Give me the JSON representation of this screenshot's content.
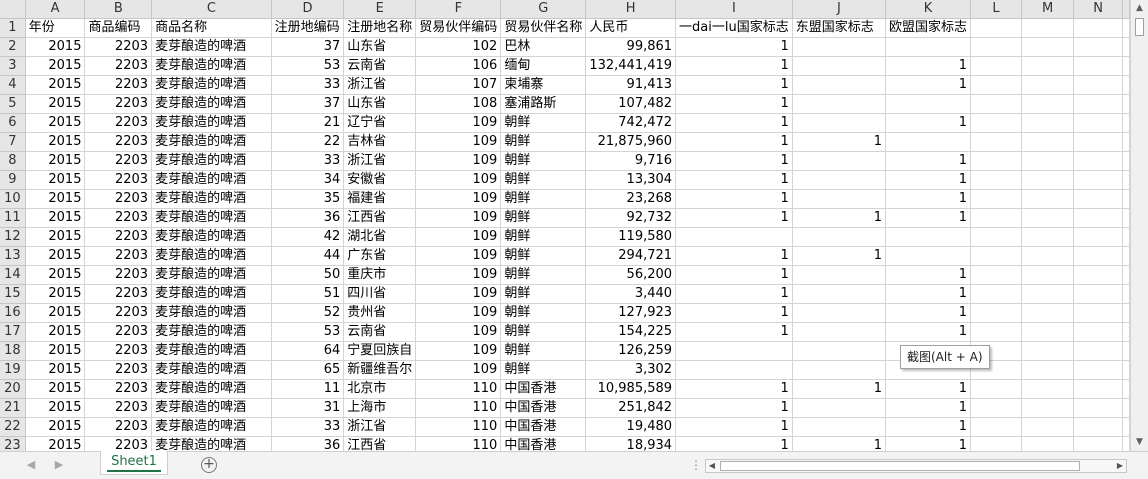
{
  "sheet": {
    "column_letters": [
      "A",
      "B",
      "C",
      "D",
      "E",
      "F",
      "G",
      "H",
      "I",
      "J",
      "K",
      "L",
      "M",
      "N"
    ],
    "header_row": {
      "row_number": "1",
      "cells": [
        "年份",
        "商品编码",
        "商品名称",
        "注册地编码",
        "注册地名称",
        "贸易伙伴编码",
        "贸易伙伴名称",
        "人民币",
        "一dai一lu国家标志",
        "东盟国家标志",
        "欧盟国家标志",
        "",
        "",
        ""
      ]
    },
    "rows": [
      {
        "n": "2",
        "year": "2015",
        "code": "2203",
        "name": "麦芽酿造的啤酒",
        "reg_code": "37",
        "reg_name": "山东省",
        "partner_code": "102",
        "partner_name": "巴林",
        "rmb": "99,861",
        "bri": "1",
        "asean": "",
        "eu": ""
      },
      {
        "n": "3",
        "year": "2015",
        "code": "2203",
        "name": "麦芽酿造的啤酒",
        "reg_code": "53",
        "reg_name": "云南省",
        "partner_code": "106",
        "partner_name": "缅甸",
        "rmb": "132,441,419",
        "bri": "1",
        "asean": "",
        "eu": "1"
      },
      {
        "n": "4",
        "year": "2015",
        "code": "2203",
        "name": "麦芽酿造的啤酒",
        "reg_code": "33",
        "reg_name": "浙江省",
        "partner_code": "107",
        "partner_name": "柬埔寨",
        "rmb": "91,413",
        "bri": "1",
        "asean": "",
        "eu": "1"
      },
      {
        "n": "5",
        "year": "2015",
        "code": "2203",
        "name": "麦芽酿造的啤酒",
        "reg_code": "37",
        "reg_name": "山东省",
        "partner_code": "108",
        "partner_name": "塞浦路斯",
        "rmb": "107,482",
        "bri": "1",
        "asean": "",
        "eu": ""
      },
      {
        "n": "6",
        "year": "2015",
        "code": "2203",
        "name": "麦芽酿造的啤酒",
        "reg_code": "21",
        "reg_name": "辽宁省",
        "partner_code": "109",
        "partner_name": "朝鲜",
        "rmb": "742,472",
        "bri": "1",
        "asean": "",
        "eu": "1"
      },
      {
        "n": "7",
        "year": "2015",
        "code": "2203",
        "name": "麦芽酿造的啤酒",
        "reg_code": "22",
        "reg_name": "吉林省",
        "partner_code": "109",
        "partner_name": "朝鲜",
        "rmb": "21,875,960",
        "bri": "1",
        "asean": "1",
        "eu": ""
      },
      {
        "n": "8",
        "year": "2015",
        "code": "2203",
        "name": "麦芽酿造的啤酒",
        "reg_code": "33",
        "reg_name": "浙江省",
        "partner_code": "109",
        "partner_name": "朝鲜",
        "rmb": "9,716",
        "bri": "1",
        "asean": "",
        "eu": "1"
      },
      {
        "n": "9",
        "year": "2015",
        "code": "2203",
        "name": "麦芽酿造的啤酒",
        "reg_code": "34",
        "reg_name": "安徽省",
        "partner_code": "109",
        "partner_name": "朝鲜",
        "rmb": "13,304",
        "bri": "1",
        "asean": "",
        "eu": "1"
      },
      {
        "n": "10",
        "year": "2015",
        "code": "2203",
        "name": "麦芽酿造的啤酒",
        "reg_code": "35",
        "reg_name": "福建省",
        "partner_code": "109",
        "partner_name": "朝鲜",
        "rmb": "23,268",
        "bri": "1",
        "asean": "",
        "eu": "1"
      },
      {
        "n": "11",
        "year": "2015",
        "code": "2203",
        "name": "麦芽酿造的啤酒",
        "reg_code": "36",
        "reg_name": "江西省",
        "partner_code": "109",
        "partner_name": "朝鲜",
        "rmb": "92,732",
        "bri": "1",
        "asean": "1",
        "eu": "1"
      },
      {
        "n": "12",
        "year": "2015",
        "code": "2203",
        "name": "麦芽酿造的啤酒",
        "reg_code": "42",
        "reg_name": "湖北省",
        "partner_code": "109",
        "partner_name": "朝鲜",
        "rmb": "119,580",
        "bri": "",
        "asean": "",
        "eu": ""
      },
      {
        "n": "13",
        "year": "2015",
        "code": "2203",
        "name": "麦芽酿造的啤酒",
        "reg_code": "44",
        "reg_name": "广东省",
        "partner_code": "109",
        "partner_name": "朝鲜",
        "rmb": "294,721",
        "bri": "1",
        "asean": "1",
        "eu": ""
      },
      {
        "n": "14",
        "year": "2015",
        "code": "2203",
        "name": "麦芽酿造的啤酒",
        "reg_code": "50",
        "reg_name": "重庆市",
        "partner_code": "109",
        "partner_name": "朝鲜",
        "rmb": "56,200",
        "bri": "1",
        "asean": "",
        "eu": "1"
      },
      {
        "n": "15",
        "year": "2015",
        "code": "2203",
        "name": "麦芽酿造的啤酒",
        "reg_code": "51",
        "reg_name": "四川省",
        "partner_code": "109",
        "partner_name": "朝鲜",
        "rmb": "3,440",
        "bri": "1",
        "asean": "",
        "eu": "1"
      },
      {
        "n": "16",
        "year": "2015",
        "code": "2203",
        "name": "麦芽酿造的啤酒",
        "reg_code": "52",
        "reg_name": "贵州省",
        "partner_code": "109",
        "partner_name": "朝鲜",
        "rmb": "127,923",
        "bri": "1",
        "asean": "",
        "eu": "1"
      },
      {
        "n": "17",
        "year": "2015",
        "code": "2203",
        "name": "麦芽酿造的啤酒",
        "reg_code": "53",
        "reg_name": "云南省",
        "partner_code": "109",
        "partner_name": "朝鲜",
        "rmb": "154,225",
        "bri": "1",
        "asean": "",
        "eu": "1"
      },
      {
        "n": "18",
        "year": "2015",
        "code": "2203",
        "name": "麦芽酿造的啤酒",
        "reg_code": "64",
        "reg_name": "宁夏回族自",
        "partner_code": "109",
        "partner_name": "朝鲜",
        "rmb": "126,259",
        "bri": "",
        "asean": "",
        "eu": ""
      },
      {
        "n": "19",
        "year": "2015",
        "code": "2203",
        "name": "麦芽酿造的啤酒",
        "reg_code": "65",
        "reg_name": "新疆维吾尔",
        "partner_code": "109",
        "partner_name": "朝鲜",
        "rmb": "3,302",
        "bri": "",
        "asean": "",
        "eu": ""
      },
      {
        "n": "20",
        "year": "2015",
        "code": "2203",
        "name": "麦芽酿造的啤酒",
        "reg_code": "11",
        "reg_name": "北京市",
        "partner_code": "110",
        "partner_name": "中国香港",
        "rmb": "10,985,589",
        "bri": "1",
        "asean": "1",
        "eu": "1"
      },
      {
        "n": "21",
        "year": "2015",
        "code": "2203",
        "name": "麦芽酿造的啤酒",
        "reg_code": "31",
        "reg_name": "上海市",
        "partner_code": "110",
        "partner_name": "中国香港",
        "rmb": "251,842",
        "bri": "1",
        "asean": "",
        "eu": "1"
      },
      {
        "n": "22",
        "year": "2015",
        "code": "2203",
        "name": "麦芽酿造的啤酒",
        "reg_code": "33",
        "reg_name": "浙江省",
        "partner_code": "110",
        "partner_name": "中国香港",
        "rmb": "19,480",
        "bri": "1",
        "asean": "",
        "eu": "1"
      },
      {
        "n": "23",
        "year": "2015",
        "code": "2203",
        "name": "麦芽酿造的啤酒",
        "reg_code": "36",
        "reg_name": "江西省",
        "partner_code": "110",
        "partner_name": "中国香港",
        "rmb": "18,934",
        "bri": "1",
        "asean": "1",
        "eu": "1"
      }
    ]
  },
  "tabs": {
    "sheet1_label": "Sheet1",
    "add_label": "+"
  },
  "tooltip": {
    "text": "截图(Alt + A)"
  },
  "colors": {
    "accent": "#217346",
    "header_bg": "#e6e6e6",
    "gridline": "#d4d4d4"
  }
}
